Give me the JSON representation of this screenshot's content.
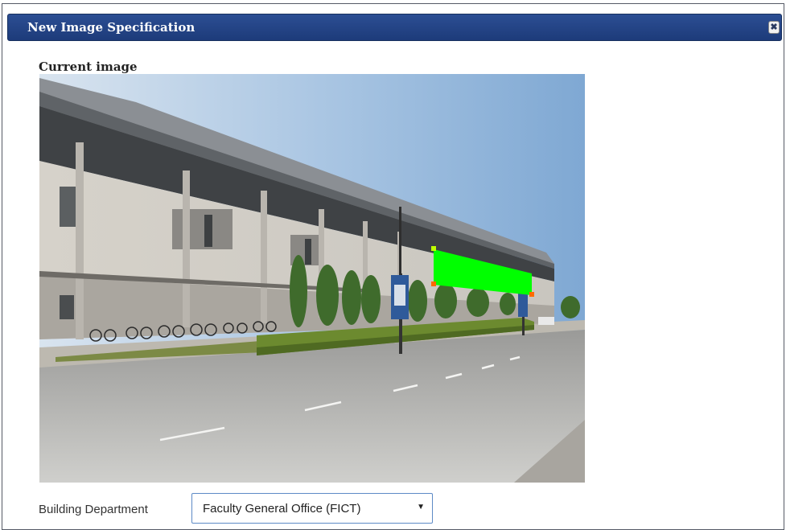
{
  "dialog": {
    "title": "New Image Specification",
    "close_icon": "close-icon",
    "title_bar_color": "#24468a"
  },
  "image_section": {
    "label": "Current image",
    "highlight_color": "#00ff00"
  },
  "form": {
    "building_department": {
      "label": "Building Department",
      "selected": "Faculty General Office (FICT)"
    }
  }
}
